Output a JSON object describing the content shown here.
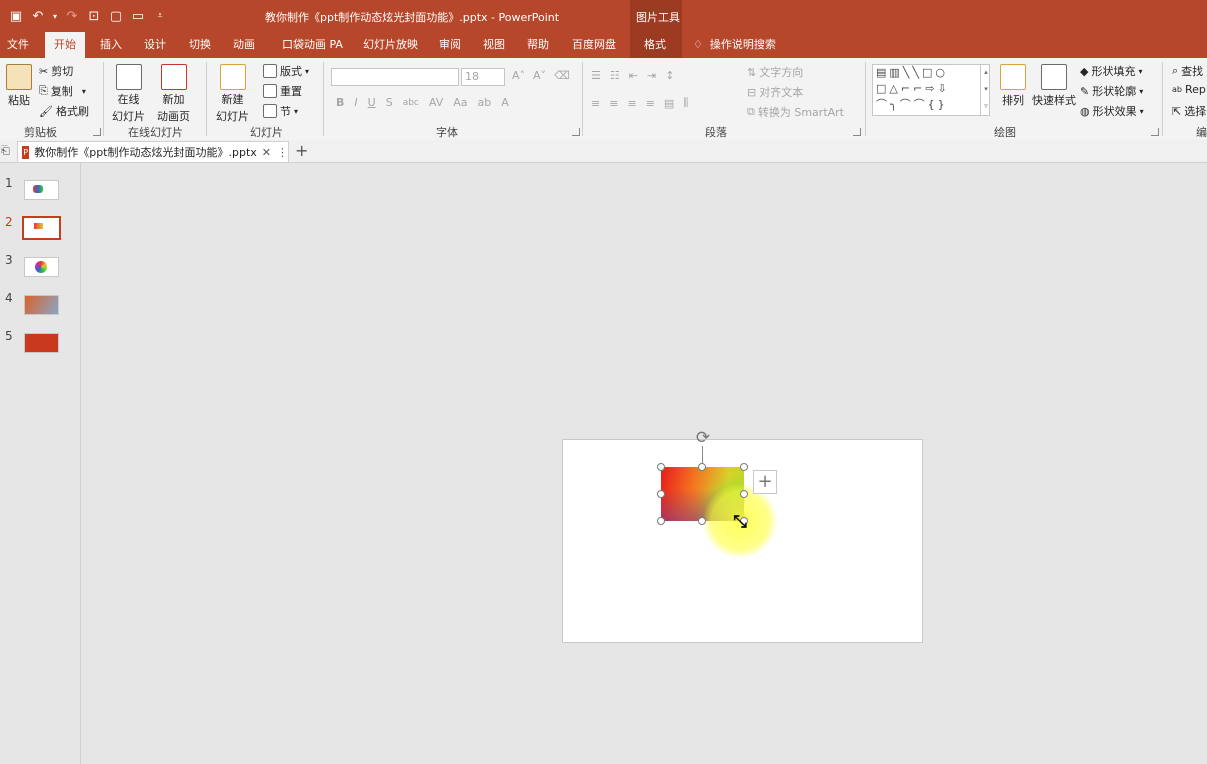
{
  "app": {
    "doc_title": "教你制作《ppt制作动态炫光封面功能》.pptx  -  PowerPoint",
    "context_tab_header": "图片工具",
    "tell_me": "操作说明搜索"
  },
  "colors": {
    "accent": "#b7472a",
    "context": "#9d3b22",
    "ribbon_bg": "#f3f3f3",
    "canvas_bg": "#e6e6e6"
  },
  "quick_access": {
    "save_icon": "save-icon",
    "undo_icon": "undo-icon",
    "redo_icon": "redo-icon",
    "customize_caret": "▾"
  },
  "tabs": [
    "文件",
    "开始",
    "插入",
    "设计",
    "切换",
    "动画",
    "口袋动画 PA",
    "幻灯片放映",
    "审阅",
    "视图",
    "帮助",
    "百度网盘",
    "格式"
  ],
  "active_tab": "开始",
  "ribbon": {
    "clipboard": {
      "paste": "粘贴",
      "cut": "剪切",
      "copy": "复制",
      "format_painter": "格式刷",
      "label": "剪贴板"
    },
    "online_slides": {
      "online": "在线\n幻灯片",
      "online_l1": "在线",
      "online_l2": "幻灯片",
      "new_anim_l1": "新加",
      "new_anim_l2": "动画页",
      "label": "在线幻灯片"
    },
    "slides": {
      "new_l1": "新建",
      "new_l2": "幻灯片",
      "layout": "版式",
      "reset": "重置",
      "section": "节",
      "label": "幻灯片"
    },
    "font": {
      "font_name": "",
      "font_size": "18",
      "label": "字体"
    },
    "paragraph": {
      "text_direction": "文字方向",
      "align_text": "对齐文本",
      "smartart": "转换为 SmartArt",
      "label": "段落"
    },
    "drawing": {
      "arrange": "排列",
      "quick_styles": "快速样式",
      "shape_fill": "形状填充",
      "shape_outline": "形状轮廓",
      "shape_effects": "形状效果",
      "label": "绘图"
    },
    "editing": {
      "find": "查找",
      "replace": "Rep",
      "select": "选择",
      "label": "编"
    }
  },
  "doc_tab": {
    "name": "教你制作《ppt制作动态炫光封面功能》.pptx"
  },
  "slides": [
    {
      "num": "1"
    },
    {
      "num": "2"
    },
    {
      "num": "3"
    },
    {
      "num": "4"
    },
    {
      "num": "5"
    }
  ],
  "selected_slide": "2"
}
